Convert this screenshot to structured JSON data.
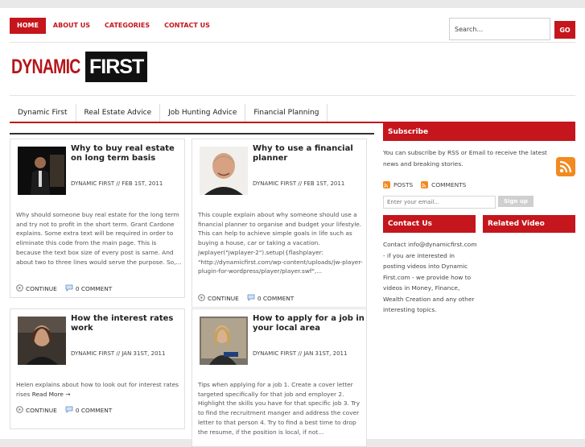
{
  "topnav": {
    "items": [
      "HOME",
      "ABOUT US",
      "CATEGORIES",
      "CONTACT US"
    ],
    "active": "HOME"
  },
  "search": {
    "value": "Search...",
    "go_label": "GO"
  },
  "logo": {
    "part1": "DYNAMIC",
    "part2": "FIRST"
  },
  "catnav": {
    "items": [
      "Dynamic First",
      "Real Estate Advice",
      "Job Hunting Advice",
      "Financial Planning"
    ]
  },
  "posts": [
    {
      "title": "Why to buy real estate on long term basis",
      "meta": "DYNAMIC FIRST // FEB 1ST, 2011",
      "excerpt": "Why should someone buy real estate for the long term and try not to profit in the short term. Grant Cardone explains. Some extra text will be required in order to eliminate this code from the main page. This is because the text box size of every post is same. And about two to three lines would serve the purpose. So,...",
      "read_more": "",
      "continue_label": "CONTINUE",
      "comments_label": "0 COMMENT"
    },
    {
      "title": "Why to use a financial planner",
      "meta": "DYNAMIC FIRST // FEB 1ST, 2011",
      "excerpt": "This couple explain about why someone should use a financial planner to organise and budget your lifestyle. This can help to achieve simple goals in life such as buying a house, car or taking a vacation. jwplayer(\"jwplayer-2\").setup({flashplayer: \"http://dynamicfirst.com/wp-content/uploads/jw-player-plugin-for-wordpress/player/player.swf\",...",
      "read_more": "",
      "continue_label": "CONTINUE",
      "comments_label": "0 COMMENT"
    },
    {
      "title": "How the interest rates work",
      "meta": "DYNAMIC FIRST // JAN 31ST, 2011",
      "excerpt": "Helen explains about how to look out for interest rates rises ",
      "read_more": "Read More →",
      "continue_label": "CONTINUE",
      "comments_label": "0 COMMENT"
    },
    {
      "title": "How to apply for a job in your local area",
      "meta": "DYNAMIC FIRST // JAN 31ST, 2011",
      "excerpt": "Tips when applying for a job 1. Create a cover letter targeted specifically for that job and employer 2. Highlight the skills you have for that specific job 3. Try to find the recruitment manger and address the cover letter to that person 4. Try to find a best time to drop the resume, if the position is local, if not...",
      "read_more": "",
      "continue_label": "CONTINUE",
      "comments_label": "0 COMMENT"
    }
  ],
  "sidebar": {
    "subscribe": {
      "title": "Subscribe",
      "text": "You can subscribe by RSS or Email to receive the latest news and breaking stories.",
      "posts_label": "POSTS",
      "comments_label": "COMMENTS",
      "email_placeholder": "Enter your email...",
      "signup_label": "Sign up"
    },
    "contact": {
      "title": "Contact Us",
      "text": "Contact info@dynamicfirst.com - if you are interested in posting videos into Dynamic First.com - we provide how to videos in Money, Finance, Wealth Creation and any other interesting topics."
    },
    "related_video": {
      "title": "Related Video"
    }
  },
  "colors": {
    "accent": "#c4161c",
    "rss": "#f38a1f"
  }
}
